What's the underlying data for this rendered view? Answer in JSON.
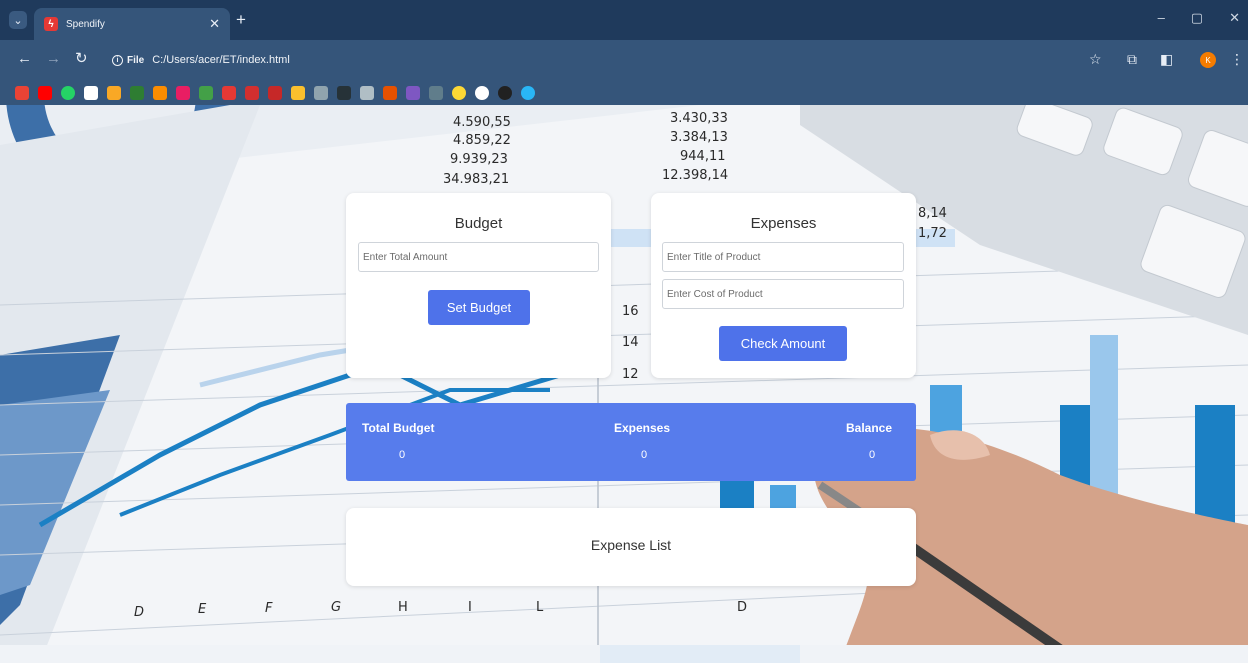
{
  "browser": {
    "tab": {
      "title": "Spendify"
    },
    "address": {
      "scheme_label": "File",
      "url": "C:/Users/acer/ET/index.html"
    },
    "profile_initial": "K"
  },
  "colors": {
    "accent": "#577cec",
    "button": "#4e72ea",
    "chrome_dark": "#1f3a5c",
    "chrome_light": "#35557a"
  },
  "background_figures": {
    "left_column": [
      "4.590,55",
      "4.859,22",
      "9.939,23",
      "34.983,21"
    ],
    "right_column": [
      "3.430,33",
      "3.384,13",
      "944,11",
      "12.398,14"
    ],
    "side_values": [
      "8,14",
      "1,72"
    ],
    "axis_numbers": [
      "16",
      "14",
      "12"
    ],
    "bottom_letters": [
      "D",
      "E",
      "F",
      "G",
      "H",
      "I",
      "L",
      "D"
    ]
  },
  "budget": {
    "title": "Budget",
    "placeholder": "Enter Total Amount",
    "button": "Set Budget"
  },
  "expenses_form": {
    "title": "Expenses",
    "title_placeholder": "Enter Title of Product",
    "cost_placeholder": "Enter Cost of Product",
    "button": "Check Amount"
  },
  "summary": {
    "total_budget_label": "Total Budget",
    "total_budget_value": "0",
    "expenses_label": "Expenses",
    "expenses_value": "0",
    "balance_label": "Balance",
    "balance_value": "0"
  },
  "expense_list": {
    "title": "Expense List"
  }
}
